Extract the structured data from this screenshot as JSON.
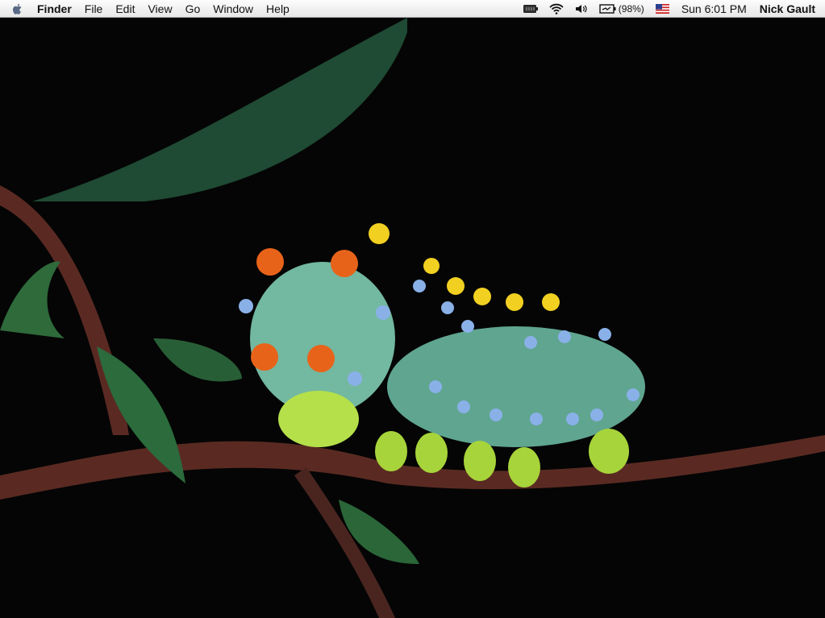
{
  "menubar": {
    "app_name": "Finder",
    "menus": [
      "File",
      "Edit",
      "View",
      "Go",
      "Window",
      "Help"
    ],
    "battery_percent": "(98%)",
    "clock": "Sun 6:01 PM",
    "user": "Nick Gault",
    "status_icons": [
      "battery-menu-icon",
      "wifi-icon",
      "volume-icon",
      "battery-charging-icon",
      "flag-us-icon"
    ]
  }
}
